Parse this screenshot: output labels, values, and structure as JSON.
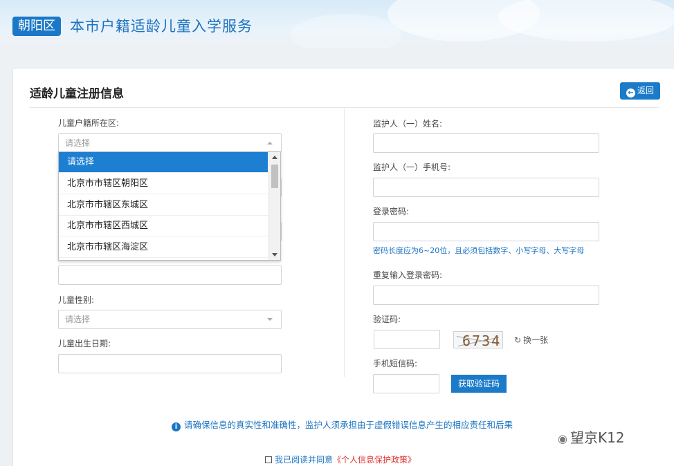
{
  "header": {
    "district": "朝阳区",
    "title": "本市户籍适龄儿童入学服务"
  },
  "form": {
    "title": "适龄儿童注册信息",
    "back_label": "返回",
    "left": {
      "hukou_label": "儿童户籍所在区:",
      "hukou_placeholder": "请选择",
      "gender_label": "儿童性别:",
      "gender_placeholder": "请选择",
      "birthdate_label": "儿童出生日期:"
    },
    "dropdown_options": [
      "请选择",
      "北京市市辖区朝阳区",
      "北京市市辖区东城区",
      "北京市市辖区西城区",
      "北京市市辖区海淀区"
    ],
    "right": {
      "guardian_name_label": "监护人（一）姓名:",
      "guardian_phone_label": "监护人（一）手机号:",
      "password_label": "登录密码:",
      "password_hint": "密码长度应为6~20位，且必须包括数字、小写字母、大写字母",
      "password_repeat_label": "重复输入登录密码:",
      "captcha_label": "验证码:",
      "captcha_value": "6734",
      "refresh_label": "换一张",
      "sms_label": "手机短信码:",
      "sms_button": "获取验证码"
    },
    "notice": "请确保信息的真实性和准确性，监护人须承担由于虚假错误信息产生的相应责任和后果",
    "agree_text": "我已阅读并同意",
    "agree_policy": "《个人信息保护政策》"
  },
  "watermark": "望京K12",
  "colors": {
    "accent": "#1b7bc8",
    "link": "#1a74c4",
    "policy": "#dd3333"
  }
}
